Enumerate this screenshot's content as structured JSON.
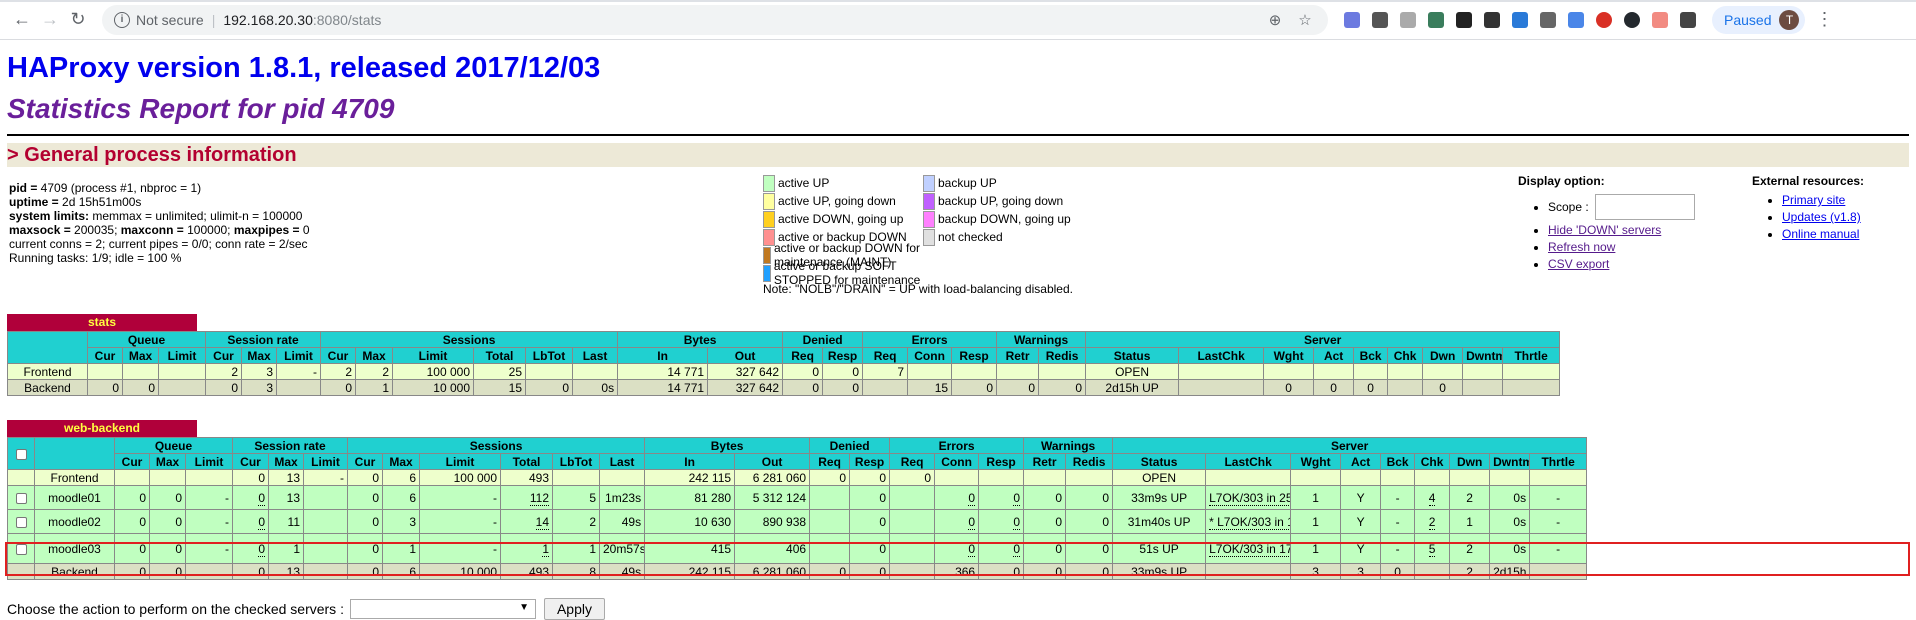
{
  "browser": {
    "security_label": "Not secure",
    "url_host": "192.168.20.30",
    "url_path": ":8080/stats",
    "profile_label": "Paused",
    "profile_initial": "T"
  },
  "page": {
    "title": "HAProxy version 1.8.1, released 2017/12/03",
    "subtitle": "Statistics Report for pid 4709",
    "section_general": "> General process information"
  },
  "process": {
    "line1_key": "pid =",
    "line1_val": " 4709 (process #1, nbproc = 1)",
    "line2_key": "uptime =",
    "line2_val": " 2d 15h51m00s",
    "line3_key": "system limits:",
    "line3_val": " memmax = unlimited; ulimit-n = 100000",
    "line4_key1": "maxsock =",
    "line4_val1": " 200035; ",
    "line4_key2": "maxconn =",
    "line4_val2": " 100000; ",
    "line4_key3": "maxpipes =",
    "line4_val3": " 0",
    "line5": "current conns = 2; current pipes = 0/0; conn rate = 2/sec",
    "line6": "Running tasks: 1/9; idle = 100 %"
  },
  "legend": {
    "left": [
      {
        "label": "active UP",
        "color": "#c0ffc0"
      },
      {
        "label": "active UP, going down",
        "color": "#ffffa0"
      },
      {
        "label": "active DOWN, going up",
        "color": "#ffd020"
      },
      {
        "label": "active or backup DOWN",
        "color": "#ff9090"
      },
      {
        "label": "active or backup DOWN for maintenance (MAINT)",
        "color": "#c07820"
      },
      {
        "label": "active or backup SOFT STOPPED for maintenance",
        "color": "#20a0ff"
      }
    ],
    "right": [
      {
        "label": "backup UP",
        "color": "#c0d0ff"
      },
      {
        "label": "backup UP, going down",
        "color": "#c060ff"
      },
      {
        "label": "backup DOWN, going up",
        "color": "#ff80ff"
      },
      {
        "label": "not checked",
        "color": "#e0e0e0"
      }
    ],
    "note": "Note: \"NOLB\"/\"DRAIN\" = UP with load-balancing disabled."
  },
  "display_options": {
    "heading": "Display option:",
    "scope_label": "Scope :",
    "links": [
      "Hide 'DOWN' servers",
      "Refresh now",
      "CSV export"
    ]
  },
  "external_resources": {
    "heading": "External resources:",
    "links": [
      "Primary site",
      "Updates (v1.8)",
      "Online manual"
    ]
  },
  "stats_table": {
    "name": "stats",
    "groups": [
      "Queue",
      "Session rate",
      "Sessions",
      "Bytes",
      "Denied",
      "Errors",
      "Warnings",
      "Server"
    ],
    "columns": [
      "Cur",
      "Max",
      "Limit",
      "Cur",
      "Max",
      "Limit",
      "Cur",
      "Max",
      "Limit",
      "Total",
      "LbTot",
      "Last",
      "In",
      "Out",
      "Req",
      "Resp",
      "Req",
      "Conn",
      "Resp",
      "Retr",
      "Redis",
      "Status",
      "LastChk",
      "Wght",
      "Act",
      "Bck",
      "Chk",
      "Dwn",
      "Dwntme",
      "Thrtle"
    ],
    "rows": [
      {
        "name": "Frontend",
        "cls": "bg-front",
        "cells": [
          "",
          "",
          "",
          "2",
          "3",
          "-",
          "2",
          "2",
          "100 000",
          "25",
          "",
          "",
          "14 771",
          "327 642",
          "0",
          "0",
          "7",
          "",
          "",
          "",
          "",
          "OPEN",
          "",
          "",
          "",
          "",
          "",
          "",
          "",
          ""
        ]
      },
      {
        "name": "Backend",
        "cls": "bg-back",
        "cells": [
          "0",
          "0",
          "",
          "0",
          "3",
          "",
          "0",
          "1",
          "10 000",
          "15",
          "0",
          "0s",
          "14 771",
          "327 642",
          "0",
          "0",
          "",
          "15",
          "0",
          "0",
          "0",
          "2d15h UP",
          "",
          "0",
          "0",
          "0",
          "",
          "0",
          "",
          ""
        ]
      }
    ]
  },
  "web_table": {
    "name": "web-backend",
    "groups": [
      "Queue",
      "Session rate",
      "Sessions",
      "Bytes",
      "Denied",
      "Errors",
      "Warnings",
      "Server"
    ],
    "columns": [
      "Cur",
      "Max",
      "Limit",
      "Cur",
      "Max",
      "Limit",
      "Cur",
      "Max",
      "Limit",
      "Total",
      "LbTot",
      "Last",
      "In",
      "Out",
      "Req",
      "Resp",
      "Req",
      "Conn",
      "Resp",
      "Retr",
      "Redis",
      "Status",
      "LastChk",
      "Wght",
      "Act",
      "Bck",
      "Chk",
      "Dwn",
      "Dwntme",
      "Thrtle"
    ],
    "rows": [
      {
        "name": "Frontend",
        "cls": "bg-front",
        "checkbox": false,
        "cells": [
          "",
          "",
          "",
          "0",
          "13",
          "-",
          "0",
          "6",
          "100 000",
          "493",
          "",
          "",
          "242 115",
          "6 281 060",
          "0",
          "0",
          "0",
          "",
          "",
          "",
          "",
          "OPEN",
          "",
          "",
          "",
          "",
          "",
          "",
          "",
          ""
        ]
      },
      {
        "name": "moodle01",
        "cls": "bg-up",
        "checkbox": true,
        "cells": [
          "0",
          "0",
          "-",
          "0",
          "13",
          "",
          "0",
          "6",
          "-",
          "112",
          "5",
          "1m23s",
          "81 280",
          "5 312 124",
          "",
          "0",
          "",
          "0",
          "0",
          "0",
          "0",
          "33m9s UP",
          "L7OK/303 in 251ms",
          "1",
          "Y",
          "-",
          "4",
          "2",
          "0s",
          "-"
        ]
      },
      {
        "name": "moodle02",
        "cls": "bg-up",
        "checkbox": true,
        "cells": [
          "0",
          "0",
          "-",
          "0",
          "11",
          "",
          "0",
          "3",
          "-",
          "14",
          "2",
          "49s",
          "10 630",
          "890 938",
          "",
          "0",
          "",
          "0",
          "0",
          "0",
          "0",
          "31m40s UP",
          "* L7OK/303 in 151ms",
          "1",
          "Y",
          "-",
          "2",
          "1",
          "0s",
          "-"
        ]
      },
      {
        "name": "moodle03",
        "cls": "bg-up",
        "checkbox": true,
        "cells": [
          "0",
          "0",
          "-",
          "0",
          "1",
          "",
          "0",
          "1",
          "-",
          "1",
          "1",
          "20m57s",
          "415",
          "406",
          "",
          "0",
          "",
          "0",
          "0",
          "0",
          "0",
          "51s UP",
          "L7OK/303 in 174ms",
          "1",
          "Y",
          "-",
          "5",
          "2",
          "0s",
          "-"
        ]
      },
      {
        "name": "Backend",
        "cls": "bg-back",
        "checkbox": false,
        "cells": [
          "0",
          "0",
          "",
          "0",
          "13",
          "",
          "0",
          "6",
          "10 000",
          "493",
          "8",
          "49s",
          "242 115",
          "6 281 060",
          "0",
          "0",
          "",
          "366",
          "0",
          "0",
          "0",
          "33m9s UP",
          "",
          "3",
          "3",
          "0",
          "",
          "2",
          "2d15h",
          ""
        ]
      }
    ]
  },
  "action": {
    "label": "Choose the action to perform on the checked servers :",
    "apply": "Apply"
  }
}
